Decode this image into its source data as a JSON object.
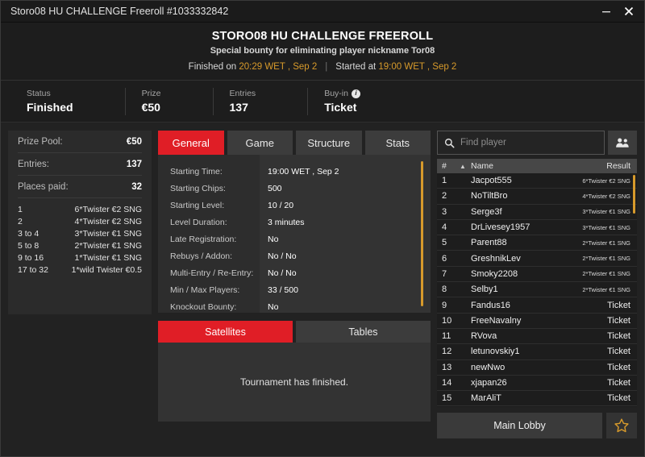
{
  "window": {
    "title": "Storo08 HU CHALLENGE Freeroll #1033332842",
    "minimize_label": "minimize",
    "close_label": "close"
  },
  "header": {
    "title": "STORO08 HU CHALLENGE FREEROLL",
    "subtitle": "Special bounty for eliminating player nickname Tor08",
    "finished_prefix": "Finished on",
    "finished_value": "20:29 WET , Sep 2",
    "divider": "|",
    "started_prefix": "Started at",
    "started_value": "19:00 WET , Sep 2"
  },
  "status": {
    "items": [
      {
        "label": "Status",
        "value": "Finished",
        "info": false
      },
      {
        "label": "Prize",
        "value": "€50",
        "info": false
      },
      {
        "label": "Entries",
        "value": "137",
        "info": false
      },
      {
        "label": "Buy-in",
        "value": "Ticket",
        "info": true
      }
    ],
    "info_glyph": "i"
  },
  "prize_panel": {
    "rows": [
      {
        "key": "Prize Pool:",
        "value": "€50"
      },
      {
        "key": "Entries:",
        "value": "137"
      },
      {
        "key": "Places paid:",
        "value": "32"
      }
    ],
    "payouts": [
      {
        "place": "1",
        "prize": "6*Twister €2 SNG"
      },
      {
        "place": "2",
        "prize": "4*Twister €2 SNG"
      },
      {
        "place": "3  to  4",
        "prize": "3*Twister €1 SNG"
      },
      {
        "place": "5  to  8",
        "prize": "2*Twister €1 SNG"
      },
      {
        "place": "9  to  16",
        "prize": "1*Twister €1 SNG"
      },
      {
        "place": "17  to  32",
        "prize": "1*wild Twister €0.5"
      }
    ]
  },
  "tabs": {
    "items": [
      "General",
      "Game",
      "Structure",
      "Stats"
    ],
    "active": "General"
  },
  "general": {
    "rows": [
      {
        "label": "Starting Time:",
        "value": "19:00 WET , Sep 2"
      },
      {
        "label": "Starting Chips:",
        "value": "500"
      },
      {
        "label": "Starting Level:",
        "value": "10 / 20"
      },
      {
        "label": "Level Duration:",
        "value": "3 minutes"
      },
      {
        "label": "Late Registration:",
        "value": "No"
      },
      {
        "label": "Rebuys / Addon:",
        "value": "No / No"
      },
      {
        "label": "Multi-Entry / Re-Entry:",
        "value": "No / No"
      },
      {
        "label": "Min / Max Players:",
        "value": "33 / 500"
      },
      {
        "label": "Knockout Bounty:",
        "value": "No"
      }
    ]
  },
  "subtabs": {
    "items": [
      "Satellites",
      "Tables"
    ],
    "active": "Satellites",
    "message": "Tournament has finished."
  },
  "search": {
    "placeholder": "Find player",
    "value": "",
    "icon": "search-icon",
    "people_icon": "people-icon"
  },
  "player_list": {
    "headers": {
      "num": "#",
      "sort": "▲",
      "name": "Name",
      "result": "Result"
    },
    "rows": [
      {
        "num": "1",
        "name": "Jacpot555",
        "result": "6*Twister €2 SNG",
        "small": true
      },
      {
        "num": "2",
        "name": "NoTiltBro",
        "result": "4*Twister €2 SNG",
        "small": true
      },
      {
        "num": "3",
        "name": "Serge3f",
        "result": "3*Twister €1 SNG",
        "small": true
      },
      {
        "num": "4",
        "name": "DrLivesey1957",
        "result": "3*Twister €1 SNG",
        "small": true
      },
      {
        "num": "5",
        "name": "Parent88",
        "result": "2*Twister €1 SNG",
        "small": true
      },
      {
        "num": "6",
        "name": "GreshnikLev",
        "result": "2*Twister €1 SNG",
        "small": true
      },
      {
        "num": "7",
        "name": "Smoky2208",
        "result": "2*Twister €1 SNG",
        "small": true
      },
      {
        "num": "8",
        "name": "Selby1",
        "result": "2*Twister €1 SNG",
        "small": true
      },
      {
        "num": "9",
        "name": "Fandus16",
        "result": "Ticket",
        "small": false
      },
      {
        "num": "10",
        "name": "FreeNavalny",
        "result": "Ticket",
        "small": false
      },
      {
        "num": "11",
        "name": "RVova",
        "result": "Ticket",
        "small": false
      },
      {
        "num": "12",
        "name": "letunovskiy1",
        "result": "Ticket",
        "small": false
      },
      {
        "num": "13",
        "name": "newNwo",
        "result": "Ticket",
        "small": false
      },
      {
        "num": "14",
        "name": "xjapan26",
        "result": "Ticket",
        "small": false
      },
      {
        "num": "15",
        "name": "MarAliT",
        "result": "Ticket",
        "small": false
      }
    ]
  },
  "footer": {
    "lobby_label": "Main Lobby",
    "favorite_icon": "star-icon"
  },
  "colors": {
    "accent_red": "#e01e26",
    "accent_gold": "#d79a2b",
    "window_bg": "#222222",
    "panel_bg": "#333333"
  }
}
